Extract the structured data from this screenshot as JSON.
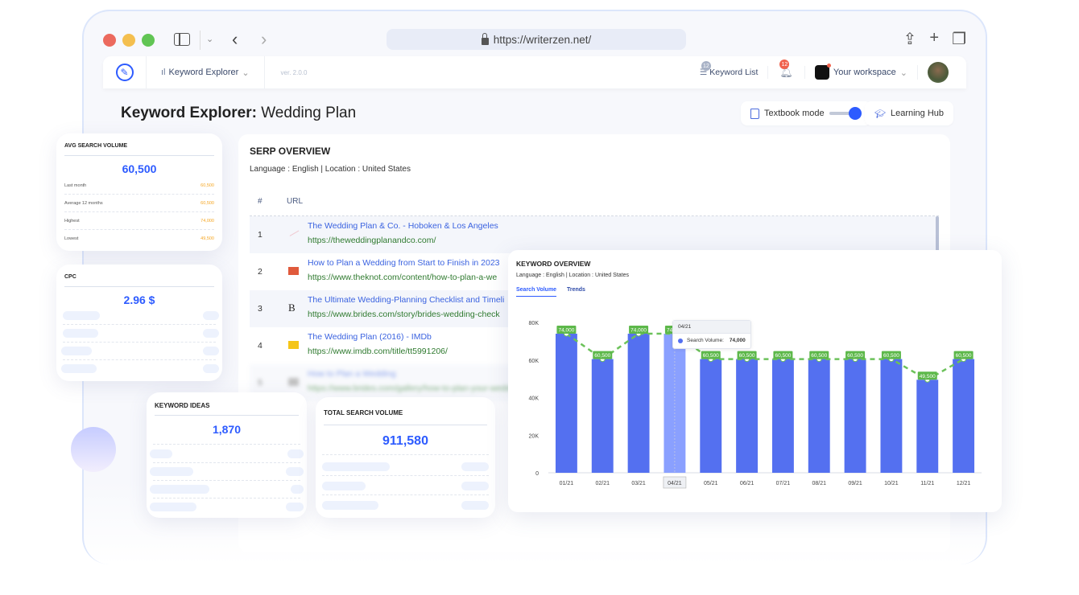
{
  "browser": {
    "url": "https://writerzen.net/",
    "icons": [
      "share-icon",
      "new-tab-icon",
      "tabs-overview-icon"
    ]
  },
  "appbar": {
    "menu_label": "Keyword Explorer",
    "version": "ver. 2.0.0",
    "keyword_list_label": "Keyword List",
    "keyword_list_count": "12",
    "notification_count": "12",
    "workspace_label": "Your workspace"
  },
  "page": {
    "title_bold": "Keyword Explorer:",
    "title_keyword": "Wedding Plan",
    "textbook_mode_label": "Textbook mode",
    "textbook_mode_on": true,
    "learning_hub_label": "Learning Hub"
  },
  "serp": {
    "title": "SERP OVERVIEW",
    "subtitle": "Language : English | Location : United States",
    "columns": [
      "#",
      "URL"
    ],
    "rows": [
      {
        "num": "1",
        "title": "The Wedding Plan & Co. - Hoboken & Los Angeles",
        "url": "https://theweddingplanandco.com/"
      },
      {
        "num": "2",
        "title": "How to Plan a Wedding from Start to Finish in 2023",
        "url": "https://www.theknot.com/content/how-to-plan-a-we"
      },
      {
        "num": "3",
        "title": "The Ultimate Wedding-Planning Checklist and Timeli",
        "url": "https://www.brides.com/story/brides-wedding-check"
      },
      {
        "num": "4",
        "title": "The Wedding Plan (2016) - IMDb",
        "url": "https://www.imdb.com/title/tt5991206/"
      },
      {
        "num": "5",
        "title": "How to Plan a Wedding",
        "url": "https://www.brides.com/gallery/how-to-plan-your-wedding"
      }
    ]
  },
  "avg_search_volume": {
    "title": "AVG SEARCH VOLUME",
    "value": "60,500",
    "rows": [
      {
        "label": "Last month",
        "value": "60,500"
      },
      {
        "label": "Average 12 months",
        "value": "60,500"
      },
      {
        "label": "Highest",
        "value": "74,000"
      },
      {
        "label": "Lowest",
        "value": "49,500"
      }
    ]
  },
  "cpc": {
    "title": "CPC",
    "value": "2.96 $"
  },
  "keyword_ideas": {
    "title": "KEYWORD IDEAS",
    "value": "1,870"
  },
  "total_search_volume": {
    "title": "TOTAL SEARCH VOLUME",
    "value": "911,580"
  },
  "keyword_overview": {
    "title": "KEYWORD OVERVIEW",
    "subtitle": "Language : English | Location : United States",
    "tabs": [
      {
        "label": "Search Volume",
        "active": true
      },
      {
        "label": "Trends",
        "active": false
      }
    ],
    "tooltip": {
      "date": "04/21",
      "series": "Search Volume:",
      "value": "74,000"
    }
  },
  "colors": {
    "accent": "#2d5bff",
    "bar": "#5470f0",
    "bar_highlight": "#8aa0ff",
    "line": "#6cc25a",
    "label_bg": "#5db84a"
  },
  "chart_data": {
    "type": "bar",
    "title": "KEYWORD OVERVIEW",
    "xlabel": "",
    "ylabel": "",
    "categories": [
      "01/21",
      "02/21",
      "03/21",
      "04/21",
      "05/21",
      "06/21",
      "07/21",
      "08/21",
      "09/21",
      "10/21",
      "11/21",
      "12/21"
    ],
    "series": [
      {
        "name": "Search Volume",
        "values": [
          74000,
          60500,
          74000,
          74000,
          60500,
          60500,
          60500,
          60500,
          60500,
          60500,
          49500,
          60500
        ]
      }
    ],
    "data_labels": [
      "74,000",
      "60,500",
      "74,000",
      "74,000",
      "60,500",
      "60,500",
      "60,500",
      "60,500",
      "60,500",
      "60,500",
      "49,500",
      "60,500"
    ],
    "overlay_line": "dashed trend line through bar tops",
    "highlighted_category": "04/21",
    "ylim": [
      0,
      80000
    ],
    "yticks": [
      0,
      20000,
      40000,
      60000,
      80000
    ],
    "ytick_labels": [
      "0",
      "20K",
      "40K",
      "60K",
      "80K"
    ],
    "grid": false
  }
}
